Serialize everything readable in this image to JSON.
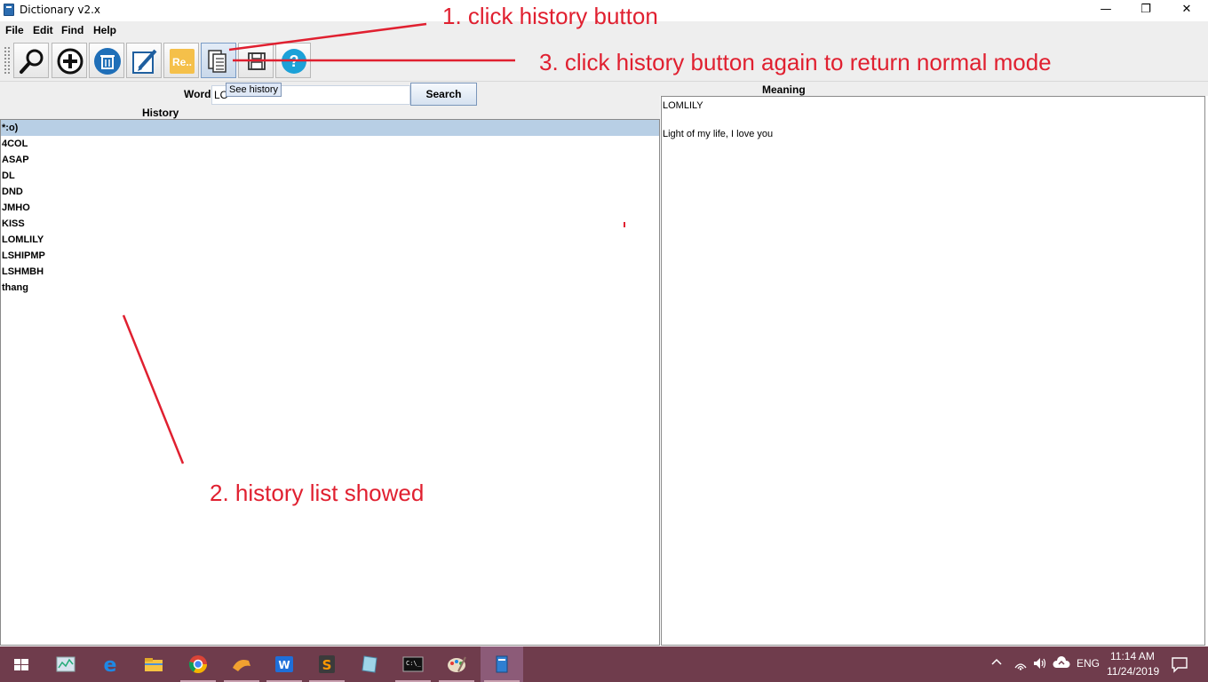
{
  "window": {
    "title": "Dictionary v2.x",
    "controls": {
      "minimize": "—",
      "maximize": "❐",
      "close": "✕"
    }
  },
  "menu": [
    "File",
    "Edit",
    "Find",
    "Help"
  ],
  "toolbar": {
    "buttons": [
      {
        "name": "search",
        "icon": "magnifier-icon"
      },
      {
        "name": "add",
        "icon": "plus-circle-icon"
      },
      {
        "name": "delete",
        "icon": "trash-icon"
      },
      {
        "name": "edit",
        "icon": "pencil-icon"
      },
      {
        "name": "rename",
        "icon": "re-icon",
        "label": "Re..."
      },
      {
        "name": "history",
        "icon": "history-icon",
        "active": true
      },
      {
        "name": "save",
        "icon": "floppy-icon"
      },
      {
        "name": "help",
        "icon": "question-icon"
      }
    ],
    "tooltip": "See history"
  },
  "search": {
    "word_label": "Word",
    "input_value": "LO",
    "button_label": "Search"
  },
  "history": {
    "title": "History",
    "items": [
      "*:o)",
      "4COL",
      "ASAP",
      "DL",
      "DND",
      "JMHO",
      "KISS",
      "LOMLILY",
      "LSHIPMP",
      "LSHMBH",
      "thang"
    ],
    "selected_index": 0
  },
  "meaning": {
    "title": "Meaning",
    "lines": [
      "LOMLILY",
      "",
      "Light of my life, I love you"
    ]
  },
  "annotations": {
    "step1": "1. click history button",
    "step2": "2. history list showed",
    "step3": "3. click history button again to return normal mode",
    "color": "#e02030"
  },
  "taskbar": {
    "apps": [
      "start-icon",
      "task-manager-icon",
      "edge-icon",
      "file-explorer-icon",
      "chrome-icon",
      "app-icon",
      "wps-icon",
      "sublime-icon",
      "notepad-icon",
      "cmd-icon",
      "paint-icon",
      "dictionary-icon"
    ],
    "language": "ENG",
    "time": "11:14 AM",
    "date": "11/24/2019",
    "background": "#6f3c4c"
  }
}
